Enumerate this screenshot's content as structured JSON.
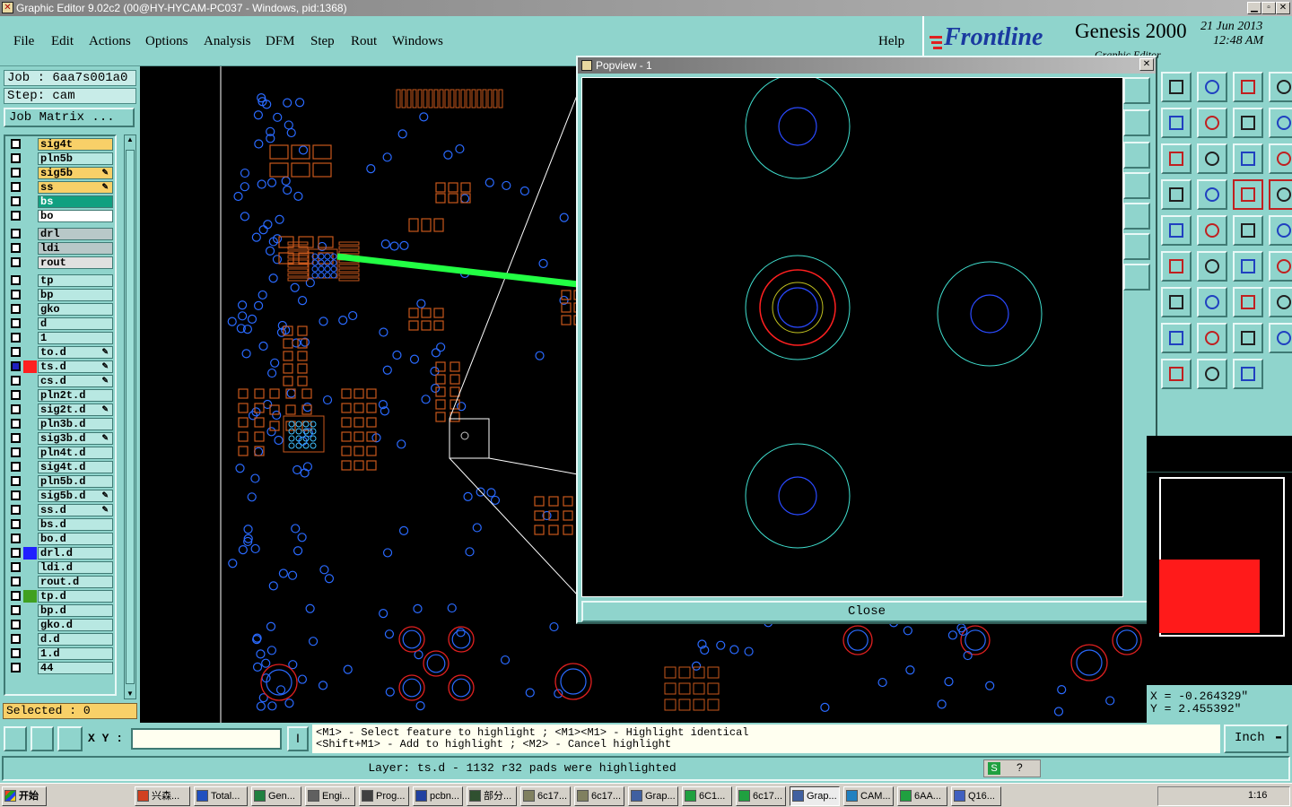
{
  "window": {
    "title": "Graphic Editor 9.02c2 (00@HY-HYCAM-PC037 - Windows, pid:1368)"
  },
  "menu": {
    "items": [
      "File",
      "Edit",
      "Actions",
      "Options",
      "Analysis",
      "DFM",
      "Step",
      "Rout",
      "Windows"
    ],
    "help": "Help"
  },
  "brand": {
    "logo": "Frontline",
    "product": "Genesis 2000",
    "date": "21 Jun 2013",
    "time": "12:48 AM",
    "subtitle": "Graphic Editor"
  },
  "job": {
    "job_line": "Job : 6aa7s001a0",
    "step_line": "Step: cam",
    "matrix_button": "Job Matrix ..."
  },
  "layers": [
    {
      "name": "sig4t",
      "bg": "#f8d068",
      "swatch": "",
      "edit": false
    },
    {
      "name": "pln5b",
      "bg": "#b8e8e2",
      "swatch": "",
      "edit": false
    },
    {
      "name": "sig5b",
      "bg": "#f8d068",
      "swatch": "",
      "edit": true
    },
    {
      "name": "ss",
      "bg": "#f8d068",
      "swatch": "",
      "edit": true
    },
    {
      "name": "bs",
      "bg": "#10a080",
      "swatch": "",
      "edit": false
    },
    {
      "name": "bo",
      "bg": "#ffffff",
      "swatch": "",
      "edit": false
    },
    {
      "name": "drl",
      "bg": "#b8c8c8",
      "swatch": "",
      "edit": false
    },
    {
      "name": "ldi",
      "bg": "#b8c8c8",
      "swatch": "",
      "edit": false
    },
    {
      "name": "rout",
      "bg": "#e0e0e0",
      "swatch": "",
      "edit": false
    },
    {
      "name": "tp",
      "bg": "#b8e8e2",
      "swatch": "",
      "edit": false
    },
    {
      "name": "bp",
      "bg": "#b8e8e2",
      "swatch": "",
      "edit": false
    },
    {
      "name": "gko",
      "bg": "#b8e8e2",
      "swatch": "",
      "edit": false
    },
    {
      "name": "d",
      "bg": "#b8e8e2",
      "swatch": "",
      "edit": false
    },
    {
      "name": "1",
      "bg": "#b8e8e2",
      "swatch": "",
      "edit": false
    },
    {
      "name": "to.d",
      "bg": "#b8e8e2",
      "swatch": "",
      "edit": true
    },
    {
      "name": "ts.d",
      "bg": "#b8e8e2",
      "swatch": "#ff2020",
      "edit": true,
      "active": true
    },
    {
      "name": "cs.d",
      "bg": "#b8e8e2",
      "swatch": "",
      "edit": true
    },
    {
      "name": "pln2t.d",
      "bg": "#b8e8e2",
      "swatch": "",
      "edit": false
    },
    {
      "name": "sig2t.d",
      "bg": "#b8e8e2",
      "swatch": "",
      "edit": true
    },
    {
      "name": "pln3b.d",
      "bg": "#b8e8e2",
      "swatch": "",
      "edit": false
    },
    {
      "name": "sig3b.d",
      "bg": "#b8e8e2",
      "swatch": "",
      "edit": true
    },
    {
      "name": "pln4t.d",
      "bg": "#b8e8e2",
      "swatch": "",
      "edit": false
    },
    {
      "name": "sig4t.d",
      "bg": "#b8e8e2",
      "swatch": "",
      "edit": false
    },
    {
      "name": "pln5b.d",
      "bg": "#b8e8e2",
      "swatch": "",
      "edit": false
    },
    {
      "name": "sig5b.d",
      "bg": "#b8e8e2",
      "swatch": "",
      "edit": true
    },
    {
      "name": "ss.d",
      "bg": "#b8e8e2",
      "swatch": "",
      "edit": true
    },
    {
      "name": "bs.d",
      "bg": "#b8e8e2",
      "swatch": "",
      "edit": false
    },
    {
      "name": "bo.d",
      "bg": "#b8e8e2",
      "swatch": "",
      "edit": false
    },
    {
      "name": "drl.d",
      "bg": "#b8e8e2",
      "swatch": "#2020ff",
      "edit": false
    },
    {
      "name": "ldi.d",
      "bg": "#b8e8e2",
      "swatch": "",
      "edit": false
    },
    {
      "name": "rout.d",
      "bg": "#b8e8e2",
      "swatch": "",
      "edit": false
    },
    {
      "name": "tp.d",
      "bg": "#b8e8e2",
      "swatch": "#40a020",
      "edit": false
    },
    {
      "name": "bp.d",
      "bg": "#b8e8e2",
      "swatch": "",
      "edit": false
    },
    {
      "name": "gko.d",
      "bg": "#b8e8e2",
      "swatch": "",
      "edit": false
    },
    {
      "name": "d.d",
      "bg": "#b8e8e2",
      "swatch": "",
      "edit": false
    },
    {
      "name": "1.d",
      "bg": "#b8e8e2",
      "swatch": "",
      "edit": false
    },
    {
      "name": "44",
      "bg": "#b8e8e2",
      "swatch": "",
      "edit": false
    }
  ],
  "selected": "Selected : 0",
  "popview": {
    "title": "Popview - 1",
    "close": "Close"
  },
  "coords": {
    "x": "X = -0.264329\"",
    "y": "Y = 2.455392\""
  },
  "bottom": {
    "xy_label": "X Y :",
    "xy_value": "",
    "hint1": "<M1> - Select feature to highlight ; <M1><M1> - Highlight identical",
    "hint2": "<Shift+M1> - Add to highlight ; <M2> - Cancel highlight",
    "units": "Inch"
  },
  "status": "Layer: ts.d - 1132 r32 pads were highlighted",
  "taskbar": {
    "start": "开始",
    "clock": "1:16",
    "tasks": [
      "兴森...",
      "Total...",
      "Gen...",
      "Engi...",
      "Prog...",
      "pcbn...",
      "部分...",
      "6c17...",
      "6c17...",
      "Grap...",
      "6C1...",
      "6c17...",
      "Grap...",
      "CAM...",
      "6AA...",
      "Q16..."
    ]
  },
  "colors": {
    "teal": "#8fd4cc",
    "pad": "#c8581c",
    "via": "#2a6aff",
    "highlight": "#ff2020",
    "arrow": "#22ff44"
  }
}
